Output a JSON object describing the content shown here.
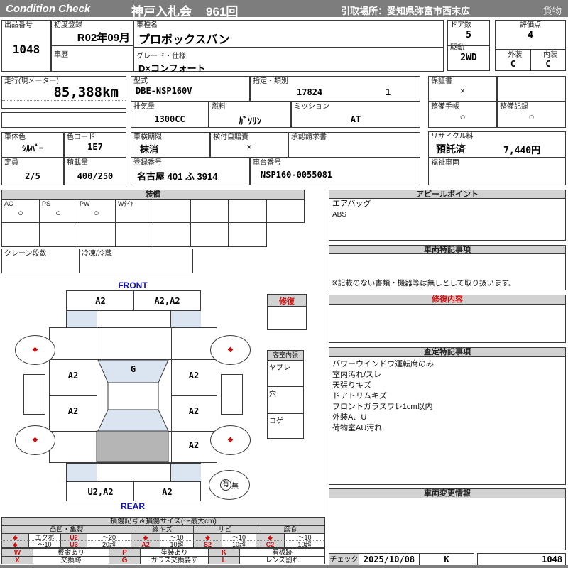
{
  "header": {
    "brand": "Condition  Check",
    "auction": "神戸入札会",
    "round": "961回",
    "pickup": "引取場所：愛知県弥富市西末広",
    "cargo": "貨物"
  },
  "info": {
    "lot_label": "出品番号",
    "lot_no": "1048",
    "first_reg_label": "初度登録",
    "first_reg": "R02年09月",
    "history_label": "車歴",
    "model_name_label": "車種名",
    "model_name": "プロボックスバン",
    "grade_label": "グレード・仕様",
    "grade": "D×コンフォート",
    "doors_label": "ドア数",
    "doors": "5",
    "drive_label": "駆動",
    "drive": "2WD",
    "score_label": "評価点",
    "score": "4",
    "exterior_label": "外装",
    "exterior": "C",
    "interior_label": "内装",
    "interior": "C",
    "mileage_label": "走行(現メーター)",
    "mileage": "85,388km",
    "model_code_label": "型式",
    "model_code": "DBE-NSP160V",
    "type_class_label": "指定・類別",
    "type_no": "17824",
    "class_no": "1",
    "warranty_label": "保証書",
    "warranty": "×",
    "displacement_label": "排気量",
    "displacement": "1300CC",
    "fuel_label": "燃料",
    "fuel": "ｶﾞｿﾘﾝ",
    "mission_label": "ミッション",
    "mission": "AT",
    "maintenance_book_label": "整備手帳",
    "maintenance_book": "○",
    "maintenance_record_label": "整備記録",
    "maintenance_record": "○",
    "body_color_label": "車体色",
    "body_color": "ｼﾙﾊﾞｰ",
    "color_code_label": "色コード",
    "color_code": "1E7",
    "inspection_label": "車検期限",
    "inspection": "抹消",
    "insurance_label": "検付自賠責",
    "insurance": "×",
    "approval_label": "承認請求書",
    "capacity_label": "定員",
    "capacity": "2/5",
    "load_label": "積載量",
    "load": "400/250",
    "reg_no_label": "登録番号",
    "reg_no": "名古屋  401 ふ  3914",
    "chassis_label": "車台番号",
    "chassis_no": "NSP160-0055081",
    "recycle_label": "リサイクル料",
    "recycle_status": "預託済",
    "recycle_fee": "7,440円",
    "welfare_label": "福祉車両"
  },
  "equipment": {
    "title": "装備",
    "cells": [
      {
        "label": "AC",
        "mark": "○"
      },
      {
        "label": "PS",
        "mark": "○"
      },
      {
        "label": "PW",
        "mark": "○"
      },
      {
        "label": "Wﾀｲﾔ",
        "mark": ""
      }
    ],
    "crane_label": "クレーン段数",
    "freezer_label": "冷凍/冷蔵"
  },
  "repair_box": {
    "title": "修復"
  },
  "cabin": {
    "title": "客室内張",
    "rows": [
      "ヤブレ",
      "穴",
      "コゲ"
    ]
  },
  "appeal": {
    "title": "アピールポイント",
    "lines": [
      "エアバッグ",
      "ABS"
    ]
  },
  "vehicle_notes": {
    "title": "車両特記事項",
    "note": "※記載のない書類・機器等は無しとして取り扱います。"
  },
  "repair_detail": {
    "title": "修復内容"
  },
  "assessment": {
    "title": "査定特記事項",
    "lines": [
      "パワーウインドウ運転席のみ",
      "室内汚れ/スレ",
      "天張りキズ",
      "ドアトリムキズ",
      "フロントガラスワレ1cm以内",
      "外装A、U",
      "荷物室AU汚れ"
    ]
  },
  "change_info": {
    "title": "車両変更情報"
  },
  "diagram": {
    "front_label": "FRONT",
    "rear_label": "REAR",
    "front_bumper_left": "A2",
    "front_bumper_right": "A2,A2",
    "windshield": "G",
    "door_front_left": "A2",
    "door_front_right": "A2",
    "door_rear_left": "A2",
    "door_rear_right": "A2",
    "quarter_rear_right": "A2",
    "rear_bumper_left": "U2,A2",
    "rear_bumper_right": "A2",
    "wheel_mark": "◆",
    "spare_present": "有",
    "spare_absent": "無"
  },
  "legend": {
    "title": "損傷記号＆損傷サイズ(～最大cm)",
    "groups": [
      "凸凹・亀裂",
      "線キズ",
      "サビ",
      "腐食"
    ],
    "row1": [
      "◆",
      "エクボ",
      "U2",
      "～20",
      "◆",
      "～10",
      "◆",
      "～10",
      "◆",
      "～10"
    ],
    "row2": [
      "◆",
      "～10",
      "U3",
      "20超",
      "A2",
      "10超",
      "S2",
      "10超",
      "C2",
      "10超"
    ],
    "codes1": [
      "W",
      "板金あり",
      "P",
      "塗装あり",
      "K",
      "看板跡"
    ],
    "codes2": [
      "X",
      "交換跡",
      "G",
      "ガラス交換要す",
      "L",
      "レンズ割れ"
    ]
  },
  "check": {
    "label": "チェック",
    "date": "2025/10/08",
    "inspector": "K",
    "number": "1048"
  },
  "colors": {
    "bar_gray": "#7d7d7d",
    "section_gray": "#d2d2d2",
    "accent_red": "#cc1111",
    "label_blue": "#1111bb",
    "glass_blue": "#dbe5f1",
    "hatch_gray": "#b5b5b5"
  }
}
